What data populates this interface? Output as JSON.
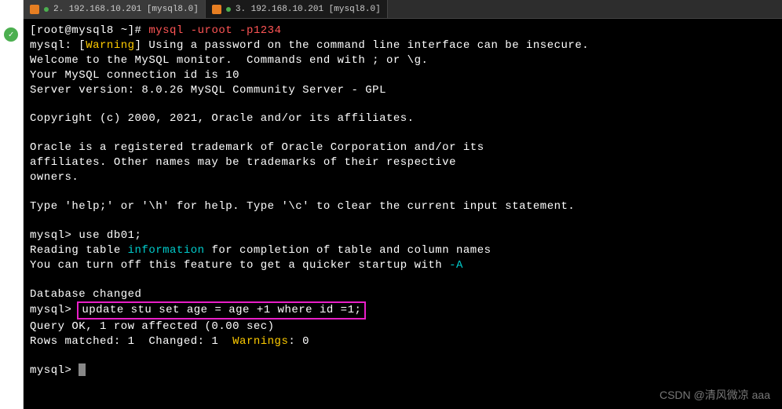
{
  "tabs": {
    "tab1_label": "2. 192.168.10.201 [mysql8.0]",
    "tab2_label": "3. 192.168.10.201 [mysql8.0]"
  },
  "prompt": {
    "user_host": "[root@mysql8 ~]# ",
    "command_mysql": "mysql ",
    "command_args": "-uroot -p1234"
  },
  "output": {
    "warn_prefix": "mysql: [",
    "warn_word": "Warning",
    "warn_suffix": "] Using a password on the command line interface can be insecure.",
    "welcome": "Welcome to the MySQL monitor.  Commands end with ; or \\g.",
    "conn_id": "Your MySQL connection id is 10",
    "version": "Server version: 8.0.26 MySQL Community Server - GPL",
    "copyright": "Copyright (c) 2000, 2021, Oracle and/or its affiliates.",
    "trademark1": "Oracle is a registered trademark of Oracle Corporation and/or its",
    "trademark2": "affiliates. Other names may be trademarks of their respective",
    "trademark3": "owners.",
    "help": "Type 'help;' or '\\h' for help. Type '\\c' to clear the current input statement.",
    "mysql_prompt": "mysql> ",
    "use_db": "use db01;",
    "reading_pre": "Reading table ",
    "reading_info": "information",
    "reading_post": " for completion of table and column names",
    "turnoff_pre": "You can turn off this feature to get a quicker startup with ",
    "turnoff_flag": "-A",
    "db_changed": "Database changed",
    "update_sql": "update stu set age = age +1 where id =1;",
    "query_ok": "Query OK, 1 row affected (0.00 sec)",
    "rows_pre": "Rows matched: 1  Changed: 1  ",
    "rows_warn": "Warnings",
    "rows_post": ": 0"
  },
  "watermark": "CSDN @清风微凉 aaa"
}
